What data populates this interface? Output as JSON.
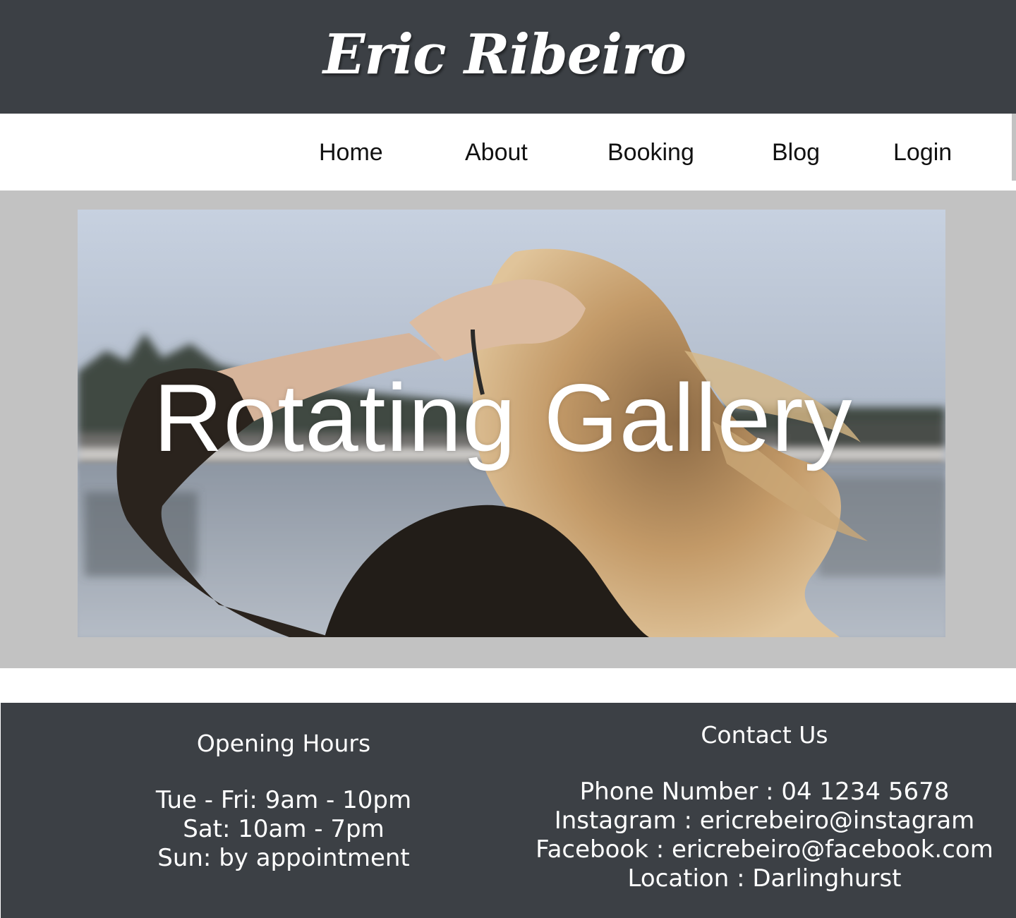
{
  "header": {
    "brand": "Eric Ribeiro"
  },
  "nav": {
    "items": [
      {
        "label": "Home"
      },
      {
        "label": "About"
      },
      {
        "label": "Booking"
      },
      {
        "label": "Blog"
      },
      {
        "label": "Login"
      }
    ]
  },
  "gallery": {
    "title": "Rotating Gallery"
  },
  "footer": {
    "hours": {
      "title": "Opening Hours",
      "lines": [
        "Tue - Fri: 9am - 10pm",
        "Sat: 10am - 7pm",
        "Sun: by appointment"
      ]
    },
    "contact": {
      "title": "Contact Us",
      "lines": [
        "Phone Number : 04 1234 5678",
        "Instagram : ericrebeiro@instagram",
        "Facebook : ericrebeiro@facebook.com",
        "Location : Darlinghurst"
      ]
    }
  },
  "colors": {
    "header_bg": "#3c4045",
    "band_bg": "#c2c2c2",
    "text_light": "#ffffff"
  }
}
